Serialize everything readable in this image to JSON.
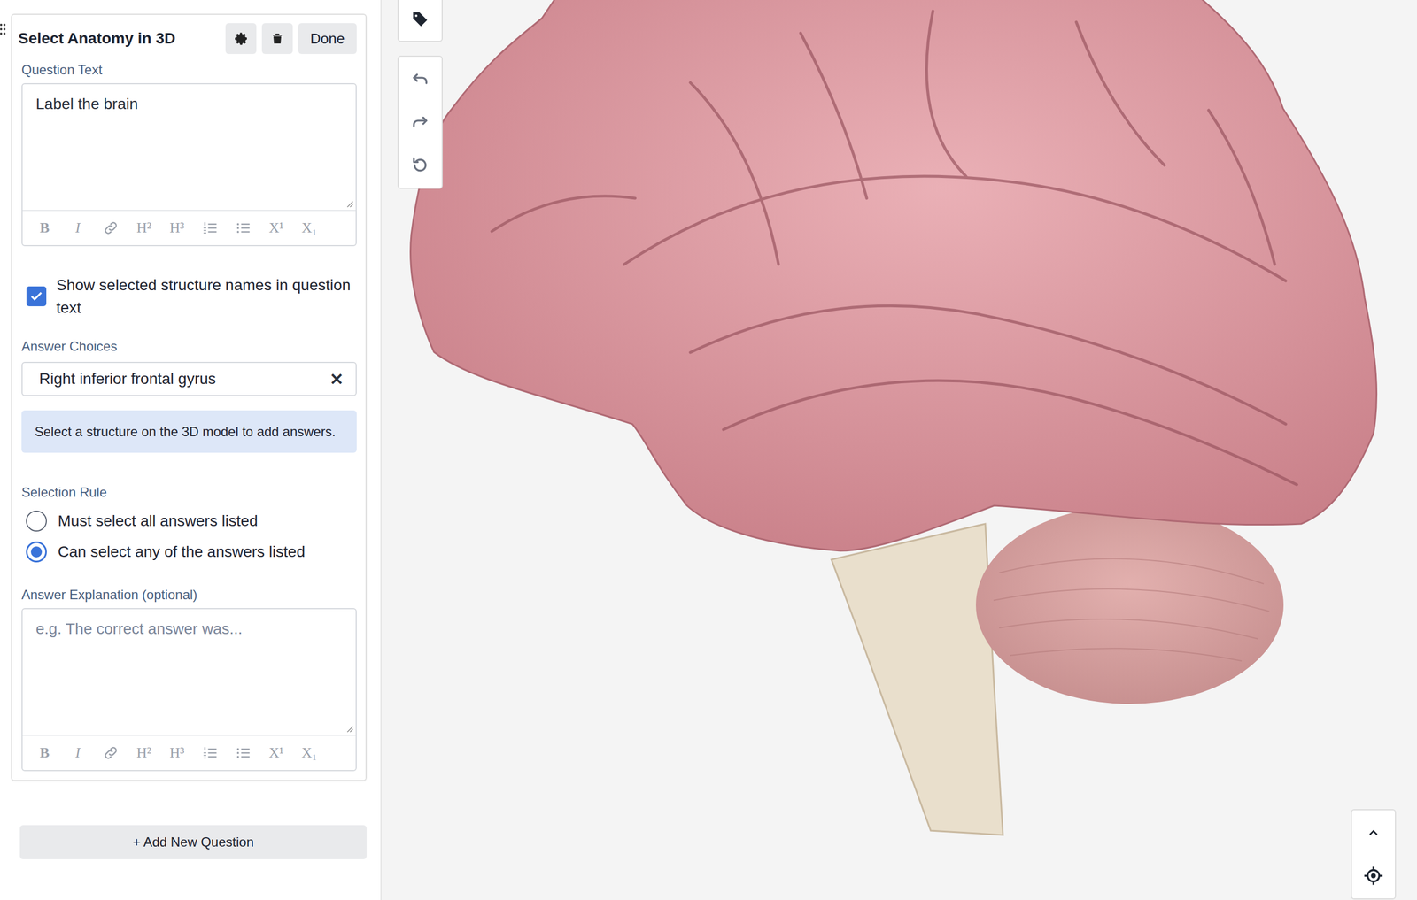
{
  "question_card": {
    "title": "Select Anatomy in 3D",
    "done_button": "Done",
    "question_text_label": "Question Text",
    "question_text": "Label the brain",
    "question_toolbar": [
      {
        "kind": "text",
        "label": "B"
      },
      {
        "kind": "text",
        "label": "I"
      },
      {
        "kind": "link"
      },
      {
        "kind": "text",
        "label": "H²"
      },
      {
        "kind": "text",
        "label": "H³"
      },
      {
        "kind": "ordered-list"
      },
      {
        "kind": "bullet-list"
      },
      {
        "kind": "text",
        "label": "X¹"
      },
      {
        "kind": "text",
        "label": "X₁"
      }
    ],
    "show_names": {
      "label": "Show selected structure names in question text",
      "checked": true
    },
    "answer_choices_label": "Answer Choices",
    "answers": [
      {
        "label": "Right inferior frontal gyrus",
        "remove": "✕"
      }
    ],
    "hint": "Select a structure on the 3D model to add answers.",
    "selection_rule_label": "Selection Rule",
    "rules": [
      {
        "label": "Must select all answers listed",
        "selected": false
      },
      {
        "label": "Can select any of the answers listed",
        "selected": true
      }
    ],
    "explanation_label": "Answer Explanation (optional)",
    "explanation_placeholder": "e.g. The correct answer was...",
    "explanation_toolbar": [
      {
        "kind": "text",
        "label": "B"
      },
      {
        "kind": "text",
        "label": "I"
      },
      {
        "kind": "link"
      },
      {
        "kind": "text",
        "label": "H²"
      },
      {
        "kind": "text",
        "label": "H³"
      },
      {
        "kind": "ordered-list"
      },
      {
        "kind": "bullet-list"
      },
      {
        "kind": "text",
        "label": "X¹"
      },
      {
        "kind": "text",
        "label": "X₁"
      }
    ]
  },
  "add_question_button": "+ Add New Question"
}
